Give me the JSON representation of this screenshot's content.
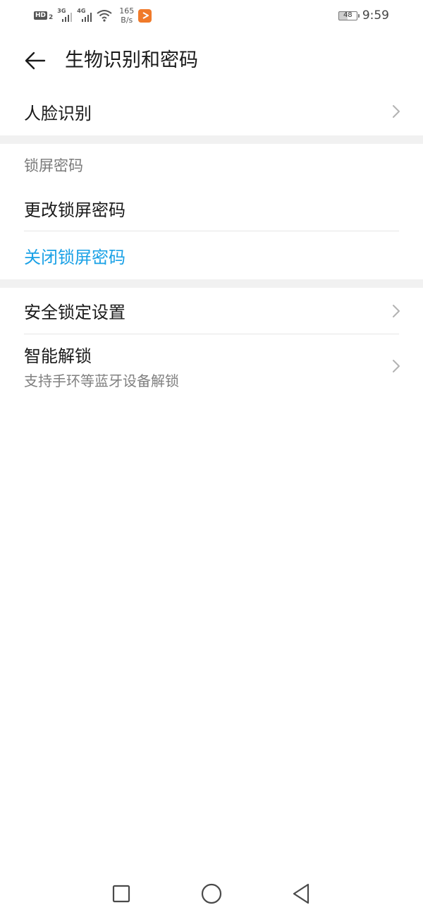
{
  "status_bar": {
    "hd_label": "HD",
    "hd_sub": "2",
    "sim1_tag": "3G",
    "sim2_tag": "4G",
    "speed_value": "165",
    "speed_unit": "B/s",
    "battery_level": "48",
    "time": "9:59",
    "icons": [
      "hd-icon",
      "signal-3g-icon",
      "signal-4g-icon",
      "wifi-icon",
      "app-notification-icon",
      "battery-icon"
    ]
  },
  "header": {
    "title": "生物识别和密码",
    "back_icon": "arrow-left-icon"
  },
  "face_group": {
    "face_recognition": "人脸识别"
  },
  "lock_group": {
    "section_title": "锁屏密码",
    "change_password": "更改锁屏密码",
    "disable_password": "关闭锁屏密码"
  },
  "security_group": {
    "secure_lock_settings": "安全锁定设置",
    "smart_unlock": "智能解锁",
    "smart_unlock_desc": "支持手环等蓝牙设备解锁"
  },
  "colors": {
    "accent": "#1aa1e6",
    "text_primary": "#1a1a1a",
    "text_secondary": "#808080",
    "separator": "#f1f1f1"
  },
  "nav_bar": {
    "icons": [
      "recent-apps-icon",
      "home-icon",
      "back-icon"
    ]
  }
}
